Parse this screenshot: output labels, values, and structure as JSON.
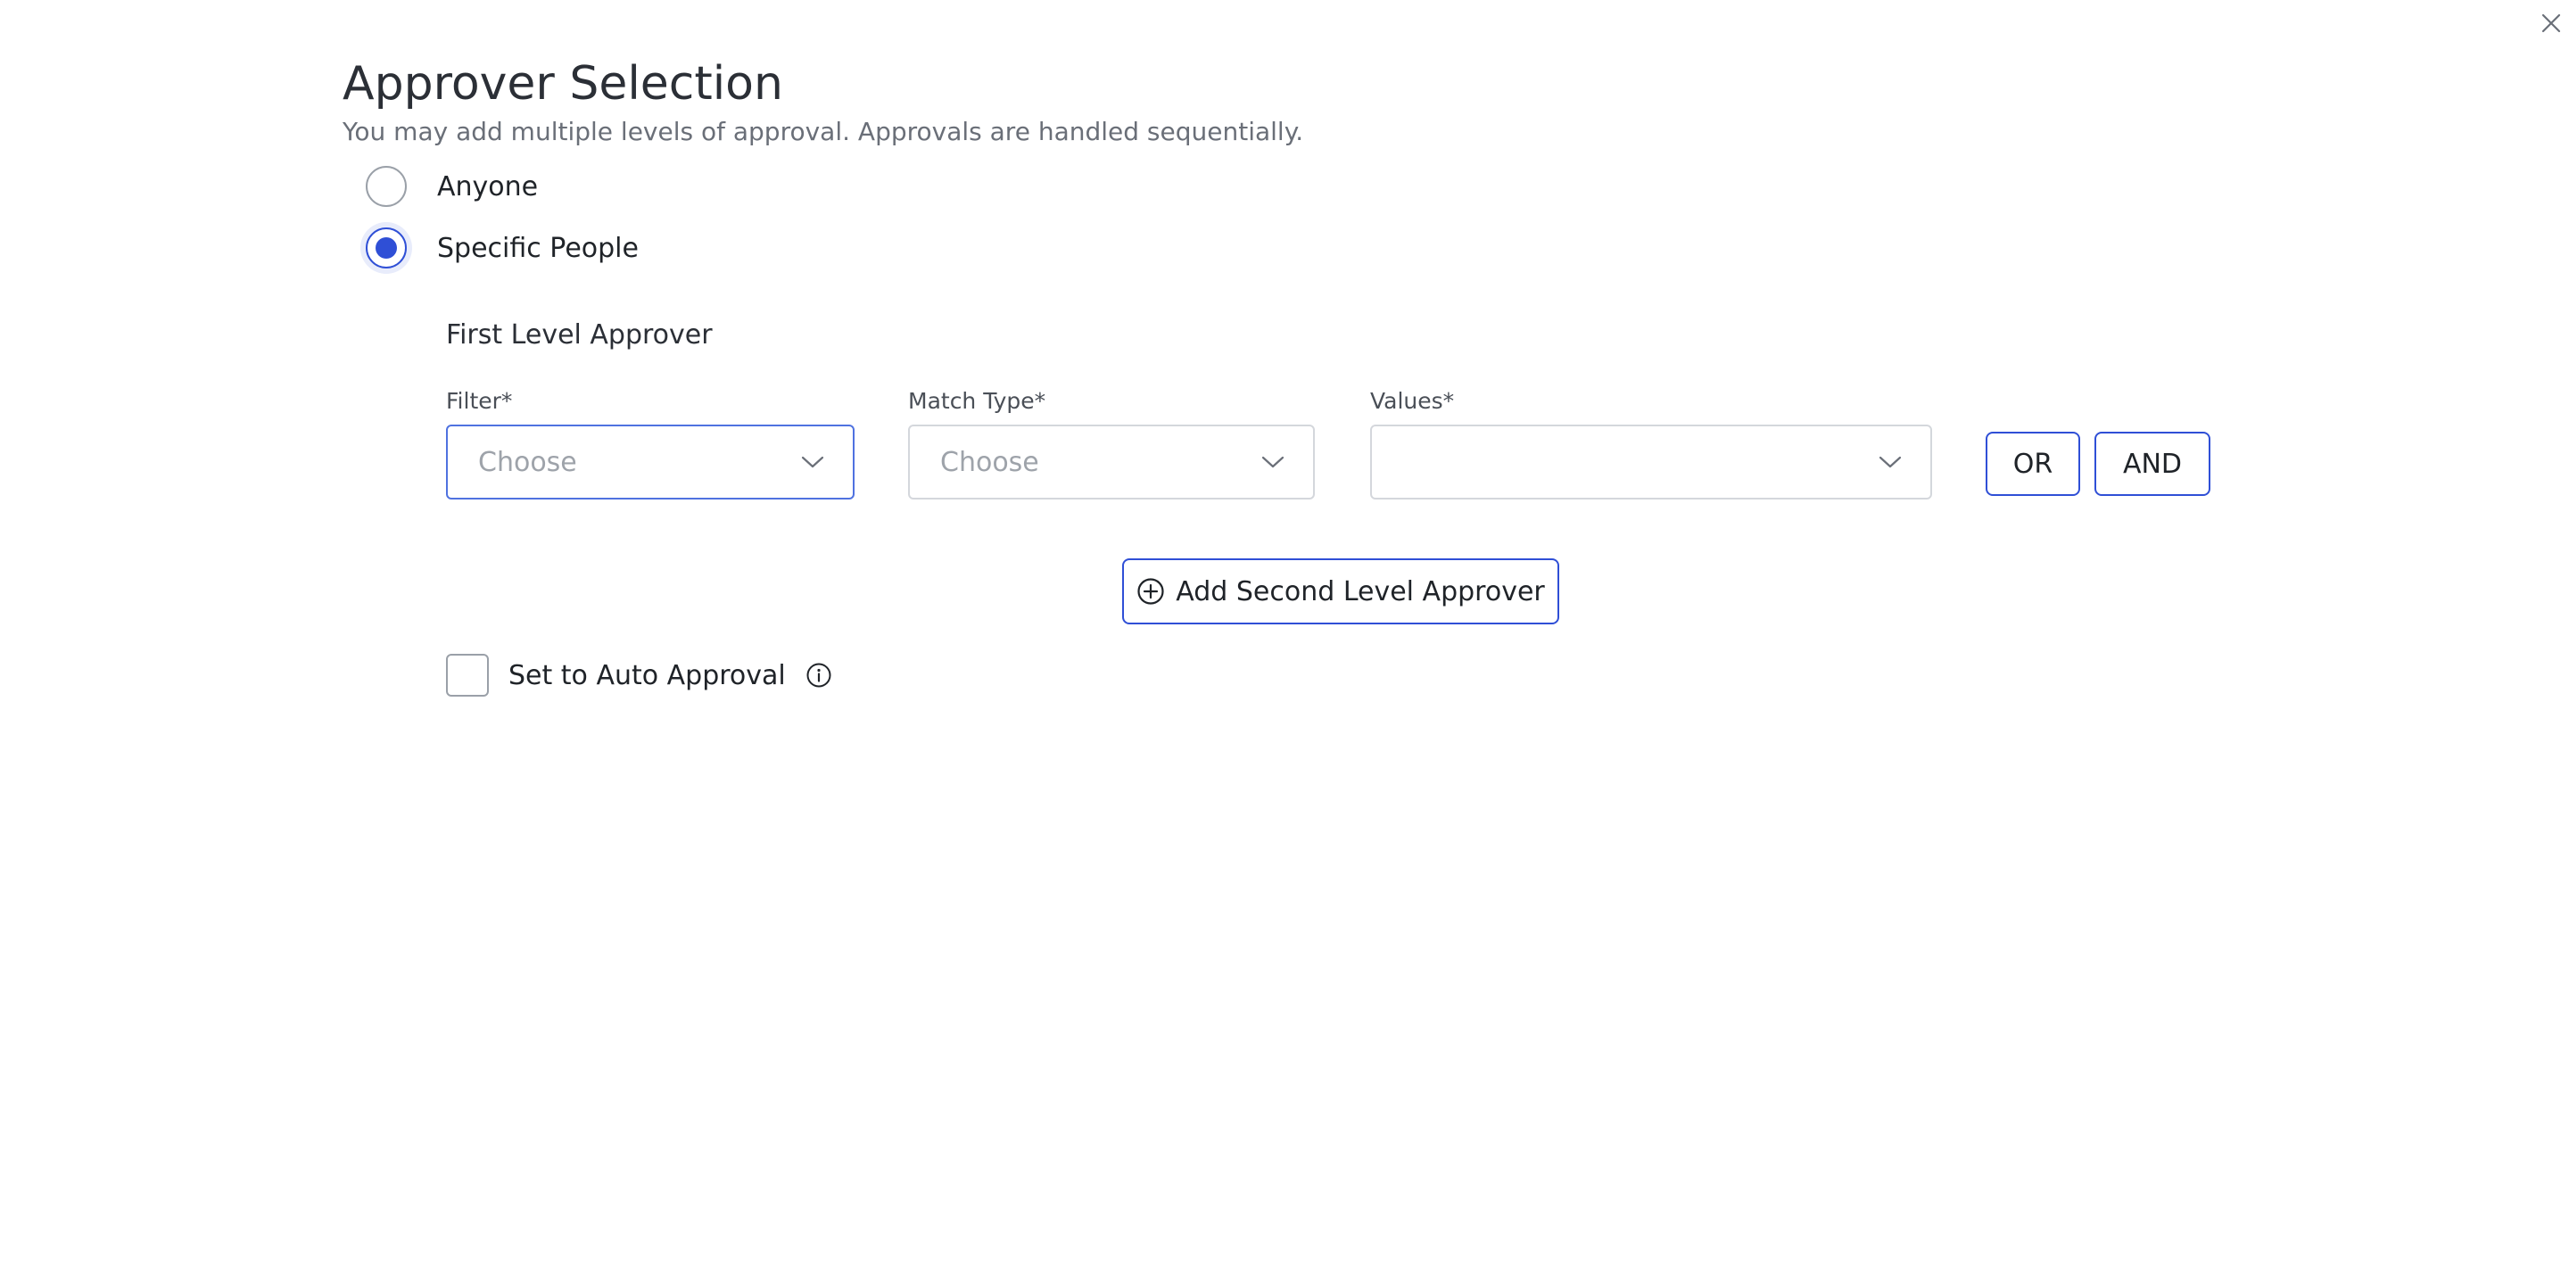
{
  "dialog": {
    "title": "Approver Selection",
    "subtitle": "You may add multiple levels of approval. Approvals are handled sequentially.",
    "close_icon": "close-icon"
  },
  "approver_type": {
    "options": [
      {
        "label": "Anyone",
        "selected": false
      },
      {
        "label": "Specific People",
        "selected": true
      }
    ]
  },
  "first_level": {
    "title": "First Level Approver",
    "filter": {
      "label": "Filter*",
      "placeholder": "Choose",
      "value": ""
    },
    "match_type": {
      "label": "Match Type*",
      "placeholder": "Choose",
      "value": ""
    },
    "values": {
      "label": "Values*",
      "placeholder": "",
      "value": ""
    },
    "or_label": "OR",
    "and_label": "AND"
  },
  "add_second_level": {
    "label": "Add Second Level Approver",
    "icon": "plus-circle-icon"
  },
  "auto_approval": {
    "label": "Set to Auto Approval",
    "checked": false,
    "icon": "info-icon"
  },
  "colors": {
    "accent": "#2f4fd6",
    "focus_border": "#4f72e0",
    "placeholder": "#9ea3aa",
    "subtitle": "#6a6f78"
  }
}
